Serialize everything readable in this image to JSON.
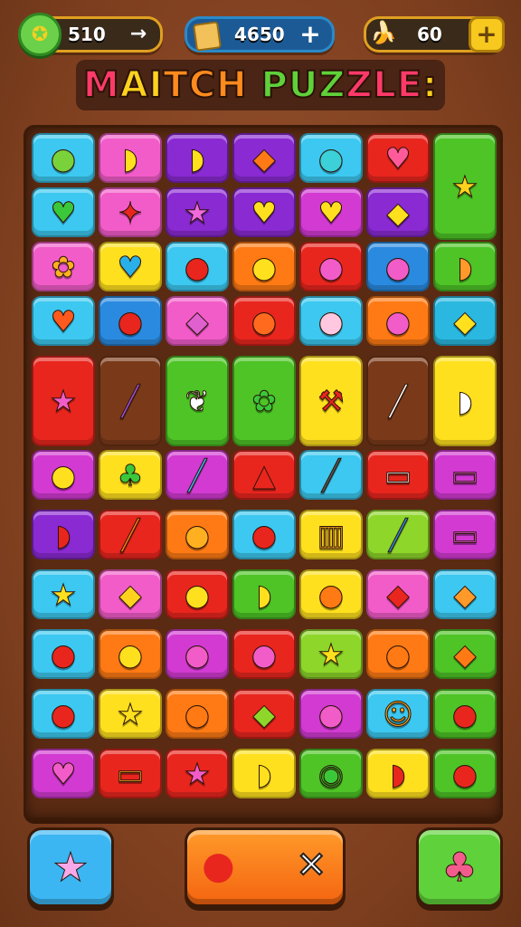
{
  "topbar": {
    "moves": {
      "value": "510",
      "arrow": "→",
      "icon": "gear-badge-icon"
    },
    "gems": {
      "value": "4650",
      "plus": "+",
      "icon": "gem-icon"
    },
    "bananas": {
      "value": "60",
      "plus": "+",
      "icon": "banana-bunch-icon"
    }
  },
  "title": {
    "segments": [
      {
        "text": "M",
        "color": "#ff3a6a"
      },
      {
        "text": "AI",
        "color": "#ffd21e"
      },
      {
        "text": "TCH ",
        "color": "#ff8a1e"
      },
      {
        "text": "PUZ",
        "color": "#5fd13a"
      },
      {
        "text": "ZLE",
        "color": "#ff3a6a"
      },
      {
        "text": ":",
        "color": "#ffd21e"
      }
    ]
  },
  "colors": {
    "cyan": "#3cc8f0",
    "pink": "#f25cc8",
    "purple": "#8a2ad2",
    "yellow": "#ffe01e",
    "red": "#e8261e",
    "green": "#4ec426",
    "orange": "#ff7a14",
    "brown": "#7a3a1a",
    "blue": "#2a8ae0",
    "lime": "#8ed62a",
    "magenta": "#d23ad2",
    "teal": "#2ab8e0"
  },
  "grid": {
    "rows": [
      [
        {
          "c": "cyan",
          "g": "●",
          "gc": "#7ad23a",
          "n": "lime-fruit-icon"
        },
        {
          "c": "pink",
          "g": "◗",
          "gc": "#ffe01e",
          "n": "banana-icon"
        },
        {
          "c": "purple",
          "g": "◗",
          "gc": "#ffe01e",
          "n": "banana-icon"
        },
        {
          "c": "purple",
          "g": "◆",
          "gc": "#ff7a14",
          "n": "carrot-icon"
        },
        {
          "c": "cyan",
          "g": "●",
          "gc": "#3cd0d8",
          "n": "blueberry-icon"
        },
        {
          "c": "red",
          "g": "♥",
          "gc": "#ff5a9a",
          "n": "apple-icon"
        },
        {
          "c": "green",
          "g": "★",
          "gc": "#ffd21e",
          "n": "berry-star-icon",
          "tall": true
        }
      ],
      [
        {
          "c": "cyan",
          "g": "♥",
          "gc": "#3ac83a",
          "n": "heart-icon"
        },
        {
          "c": "pink",
          "g": "✦",
          "gc": "#e8261e",
          "n": "chili-icon"
        },
        {
          "c": "purple",
          "g": "★",
          "gc": "#f06adc",
          "n": "star-icon"
        },
        {
          "c": "purple",
          "g": "♥",
          "gc": "#ffe01e",
          "n": "heart-icon"
        },
        {
          "c": "magenta",
          "g": "♥",
          "gc": "#ffe01e",
          "n": "heart-icon"
        },
        {
          "c": "purple",
          "g": "◆",
          "gc": "#ffe01e",
          "n": "pear-icon"
        },
        null
      ],
      [
        {
          "c": "pink",
          "g": "✿",
          "gc": "#ffb020",
          "n": "cupcake-icon"
        },
        {
          "c": "yellow",
          "g": "♥",
          "gc": "#2ab0e8",
          "n": "heart-icon"
        },
        {
          "c": "cyan",
          "g": "●",
          "gc": "#e8261e",
          "n": "bean-icon"
        },
        {
          "c": "orange",
          "g": "●",
          "gc": "#ffe01e",
          "n": "lemon-icon"
        },
        {
          "c": "red",
          "g": "●",
          "gc": "#f25cc8",
          "n": "peach-icon"
        },
        {
          "c": "blue",
          "g": "●",
          "gc": "#f25cc8",
          "n": "peach-icon"
        },
        {
          "c": "green",
          "g": "◗",
          "gc": "#ff9a2a",
          "n": "bread-icon"
        }
      ],
      [
        {
          "c": "cyan",
          "g": "♥",
          "gc": "#ff5a1e",
          "n": "heart-icon"
        },
        {
          "c": "blue",
          "g": "●",
          "gc": "#e8261e",
          "n": "apple-icon"
        },
        {
          "c": "pink",
          "g": "◆",
          "gc": "#e060d0",
          "n": "eggplant-icon"
        },
        {
          "c": "red",
          "g": "●",
          "gc": "#ff6a1e",
          "n": "orange-icon"
        },
        {
          "c": "cyan",
          "g": "●",
          "gc": "#ffc8e0",
          "n": "peach-icon"
        },
        {
          "c": "orange",
          "g": "●",
          "gc": "#f25cc8",
          "n": "peach-icon"
        },
        {
          "c": "teal",
          "g": "◆",
          "gc": "#ffe01e",
          "n": "corn-icon"
        }
      ],
      [
        {
          "c": "red",
          "g": "★",
          "gc": "#f25cc8",
          "n": "star-heart-icon",
          "tall": true
        },
        {
          "c": "brown",
          "g": "╱",
          "gc": "#a050e0",
          "n": "wand-icon",
          "tall": true
        },
        {
          "c": "green",
          "g": "❦",
          "gc": "#ffffff",
          "n": "cookie-icon",
          "tall": true
        },
        {
          "c": "green",
          "g": "✿",
          "gc": "#3ac83a",
          "n": "leaf-icon",
          "tall": true
        },
        {
          "c": "yellow",
          "g": "⚒",
          "gc": "#e8261e",
          "n": "hammer-icon",
          "tall": true
        },
        {
          "c": "brown",
          "g": "╱",
          "gc": "#ffffff",
          "n": "pencil-icon",
          "tall": true
        },
        {
          "c": "yellow",
          "g": "◗",
          "gc": "#ffffff",
          "n": "ghost-icon",
          "tall": true
        }
      ],
      null,
      [
        {
          "c": "magenta",
          "g": "●",
          "gc": "#ffe01e",
          "n": "lemon-icon"
        },
        {
          "c": "yellow",
          "g": "♣",
          "gc": "#3ac83a",
          "n": "plant-pot-icon"
        },
        {
          "c": "magenta",
          "g": "╱",
          "gc": "#3cb6f2",
          "n": "crayon-icon"
        },
        {
          "c": "red",
          "g": "▲",
          "gc": "#e8261e",
          "n": "pizza-slice-icon"
        },
        {
          "c": "cyan",
          "g": "╱",
          "gc": "#555555",
          "n": "marker-icon"
        },
        {
          "c": "red",
          "g": "▭",
          "gc": "#ffffff",
          "n": "toolbox-icon"
        },
        {
          "c": "magenta",
          "g": "▭",
          "gc": "#e060d0",
          "n": "bucket-icon"
        }
      ],
      [
        {
          "c": "purple",
          "g": "◗",
          "gc": "#e8261e",
          "n": "watermelon-icon"
        },
        {
          "c": "red",
          "g": "╱",
          "gc": "#ff7a14",
          "n": "crayon-icon"
        },
        {
          "c": "orange",
          "g": "●",
          "gc": "#ffb020",
          "n": "orange-icon"
        },
        {
          "c": "cyan",
          "g": "●",
          "gc": "#e8261e",
          "n": "apple-icon"
        },
        {
          "c": "yellow",
          "g": "▥",
          "gc": "#ffb020",
          "n": "jar-icon"
        },
        {
          "c": "lime",
          "g": "╱",
          "gc": "#2a8ae0",
          "n": "crayon-icon"
        },
        {
          "c": "magenta",
          "g": "▭",
          "gc": "#e060d0",
          "n": "case-icon"
        }
      ],
      [
        {
          "c": "cyan",
          "g": "★",
          "gc": "#ffe01e",
          "n": "star-icon"
        },
        {
          "c": "pink",
          "g": "◆",
          "gc": "#ffd21e",
          "n": "pepper-icon"
        },
        {
          "c": "red",
          "g": "●",
          "gc": "#ffe01e",
          "n": "cookie-icon"
        },
        {
          "c": "green",
          "g": "◗",
          "gc": "#ffe01e",
          "n": "banana-icon"
        },
        {
          "c": "yellow",
          "g": "●",
          "gc": "#ff7a14",
          "n": "orange-icon"
        },
        {
          "c": "pink",
          "g": "◆",
          "gc": "#e8261e",
          "n": "chili-icon"
        },
        {
          "c": "cyan",
          "g": "◆",
          "gc": "#ff9a2a",
          "n": "carrot-icon"
        }
      ],
      [
        {
          "c": "cyan",
          "g": "●",
          "gc": "#e8261e",
          "n": "apple-icon"
        },
        {
          "c": "orange",
          "g": "●",
          "gc": "#ffe01e",
          "n": "lemon-icon"
        },
        {
          "c": "magenta",
          "g": "●",
          "gc": "#f25cc8",
          "n": "plum-icon"
        },
        {
          "c": "red",
          "g": "●",
          "gc": "#f25cc8",
          "n": "peach-icon"
        },
        {
          "c": "lime",
          "g": "★",
          "gc": "#ffe01e",
          "n": "star-icon"
        },
        {
          "c": "orange",
          "g": "●",
          "gc": "#ff7a14",
          "n": "orange-icon"
        },
        {
          "c": "green",
          "g": "◆",
          "gc": "#ff7a14",
          "n": "carrot-icon"
        }
      ],
      [
        {
          "c": "cyan",
          "g": "●",
          "gc": "#e8261e",
          "n": "apple-icon"
        },
        {
          "c": "yellow",
          "g": "★",
          "gc": "#ffe01e",
          "n": "star-icon"
        },
        {
          "c": "orange",
          "g": "●",
          "gc": "#ff7a14",
          "n": "orange-icon"
        },
        {
          "c": "red",
          "g": "◆",
          "gc": "#8ed62a",
          "n": "pepper-icon"
        },
        {
          "c": "magenta",
          "g": "●",
          "gc": "#f25cc8",
          "n": "plum-icon"
        },
        {
          "c": "cyan",
          "g": "☺",
          "gc": "#ffb020",
          "n": "critter-icon"
        },
        {
          "c": "green",
          "g": "●",
          "gc": "#e8261e",
          "n": "apple-icon"
        }
      ],
      [
        {
          "c": "magenta",
          "g": "♥",
          "gc": "#f25cc8",
          "n": "heart-icon"
        },
        {
          "c": "red",
          "g": "▭",
          "gc": "#ffb020",
          "n": "cheese-icon"
        },
        {
          "c": "red",
          "g": "★",
          "gc": "#f25cc8",
          "n": "star-icon"
        },
        {
          "c": "yellow",
          "g": "◗",
          "gc": "#ffe01e",
          "n": "banana-icon"
        },
        {
          "c": "green",
          "g": "◉",
          "gc": "#3ac83a",
          "n": "basket-icon"
        },
        {
          "c": "yellow",
          "g": "◗",
          "gc": "#e8261e",
          "n": "chili-pair-icon"
        },
        {
          "c": "green",
          "g": "●",
          "gc": "#e8261e",
          "n": "apple-icon"
        }
      ]
    ]
  },
  "bottom": {
    "left": {
      "icon": "star-booster-icon"
    },
    "middle": {
      "icon_left": "cherry-star-icon",
      "icon_right": "shuffle-icon"
    },
    "right": {
      "icon": "potion-cup-icon"
    }
  }
}
